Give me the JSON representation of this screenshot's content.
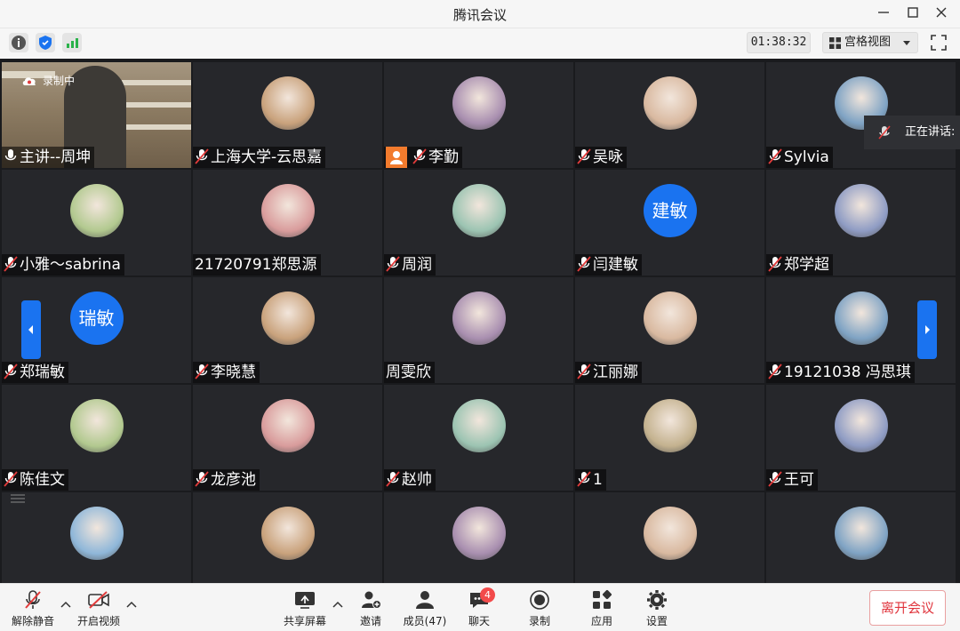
{
  "window": {
    "title": "腾讯会议"
  },
  "toolbar": {
    "timer": "01:38:32",
    "view_label": "宫格视图"
  },
  "speaking": {
    "label": "正在讲话:"
  },
  "participants": [
    {
      "name": "主讲--周坤",
      "badge": "录制中"
    },
    {
      "name": "上海大学-云思嘉"
    },
    {
      "name": "李勤"
    },
    {
      "name": "吴咏"
    },
    {
      "name": "Sylvia"
    },
    {
      "name": "小雅～sabrina"
    },
    {
      "name": "21720791郑思源"
    },
    {
      "name": "周润"
    },
    {
      "name": "闫建敏",
      "avatar_text": "建敏"
    },
    {
      "name": "郑学超"
    },
    {
      "name": "郑瑞敏",
      "avatar_text": "瑞敏"
    },
    {
      "name": "李晓慧"
    },
    {
      "name": "周雯欣"
    },
    {
      "name": "江丽娜"
    },
    {
      "name": "19121038 冯思琪"
    },
    {
      "name": "陈佳文"
    },
    {
      "name": "龙彦池"
    },
    {
      "name": "赵帅"
    },
    {
      "name": "1"
    },
    {
      "name": "王可"
    },
    {
      "name": ""
    },
    {
      "name": ""
    },
    {
      "name": ""
    },
    {
      "name": ""
    },
    {
      "name": ""
    }
  ],
  "bottom": {
    "unmute": "解除静音",
    "video": "开启视频",
    "share": "共享屏幕",
    "invite": "邀请",
    "members": "成员(47)",
    "chat": "聊天",
    "chat_badge": "4",
    "record": "录制",
    "apps": "应用",
    "settings": "设置",
    "leave": "离开会议"
  },
  "colors": {
    "accent": "#1a73f0",
    "tile_bg": "#26272b",
    "leave": "#e0353d",
    "badge": "#f24a4a"
  }
}
